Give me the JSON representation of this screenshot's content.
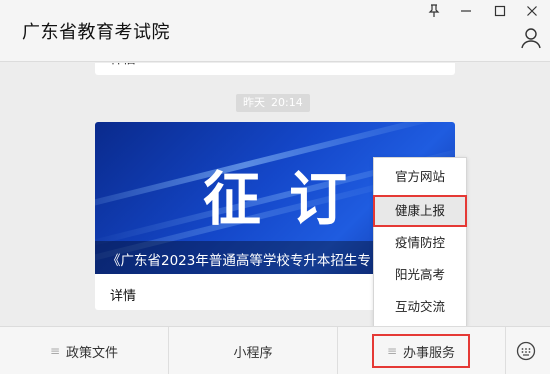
{
  "window": {
    "title": "广东省教育考试院",
    "pin_icon": "pin-icon",
    "minimize_icon": "minimize-icon",
    "maximize_icon": "maximize-icon",
    "close_icon": "close-icon",
    "user_icon": "user-icon"
  },
  "chat": {
    "previous_card": {
      "label": "详情",
      "chevron": "›"
    },
    "timestamp": {
      "day": "昨天",
      "time": "20:14"
    },
    "article": {
      "banner_text": "征订",
      "caption": "《广东省2023年普通高等学校专升本招生专",
      "detail_label": "详情"
    }
  },
  "menu": {
    "items": [
      {
        "label": "官方网站"
      },
      {
        "label": "健康上报"
      },
      {
        "label": "疫情防控"
      },
      {
        "label": "阳光高考"
      },
      {
        "label": "互动交流"
      }
    ],
    "highlighted_color": "#e53935"
  },
  "bottom_bar": {
    "tabs": [
      {
        "label": "政策文件",
        "icon": "≡"
      },
      {
        "label": "小程序"
      },
      {
        "label": "办事服务",
        "icon": "≡"
      }
    ],
    "keyboard_icon": "keyboard-icon"
  },
  "colors": {
    "banner_blue": "#1447c9",
    "highlight_red": "#e53935"
  }
}
